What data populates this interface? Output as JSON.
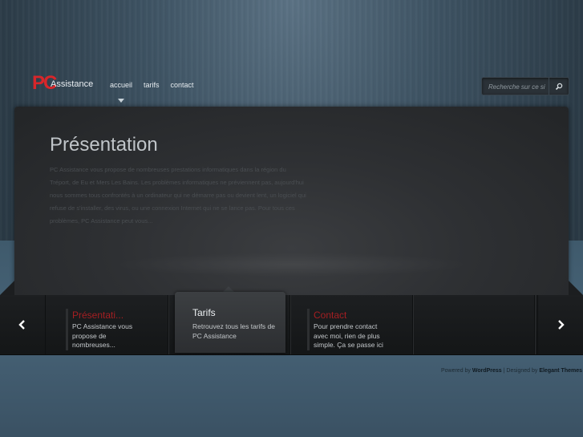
{
  "logo": {
    "pc": "PC",
    "name": "Assistance"
  },
  "nav": [
    {
      "label": "accueil",
      "active": true
    },
    {
      "label": "tarifs"
    },
    {
      "label": "contact"
    }
  ],
  "search": {
    "placeholder": "Recherche sur ce si",
    "icon": "search-icon"
  },
  "presentation": {
    "title": "Présentation",
    "text": "PC Assistance vous propose de nombreuses prestations informatiques dans la région du Tréport, de Eu et Mers Les Bains. Les problèmes informatiques ne préviennent pas, aujourd'hui nous sommes tous confrontés à un ordinateur qui ne démarre pas ou devient lent, un logiciel qui refuse de s'installer, des virus, ou une connexion Internet qui ne se lance pas. Pour tous ces problèmes, PC Assistance peut vous..."
  },
  "slider": {
    "prev_icon": "chevron-left-icon",
    "next_icon": "chevron-right-icon",
    "items": [
      {
        "title": "Présentati...",
        "desc": "PC Assistance vous propose de nombreuses..."
      },
      {
        "title": "Tarifs",
        "desc": "Retrouvez tous les tarifs de PC Assistance"
      },
      {
        "title": "Contact",
        "desc": "Pour prendre contact avec moi, rien de plus simple. Ça se passe ici"
      }
    ]
  },
  "footer": {
    "powered": "Powered by",
    "wordpress": "WordPress",
    "designed": "| Designed by",
    "elegant": "Elegant Themes"
  },
  "colors": {
    "accent": "#a51e22",
    "logo_red": "#d8262a",
    "panel": "#2e3033",
    "background": "#3e5363"
  }
}
